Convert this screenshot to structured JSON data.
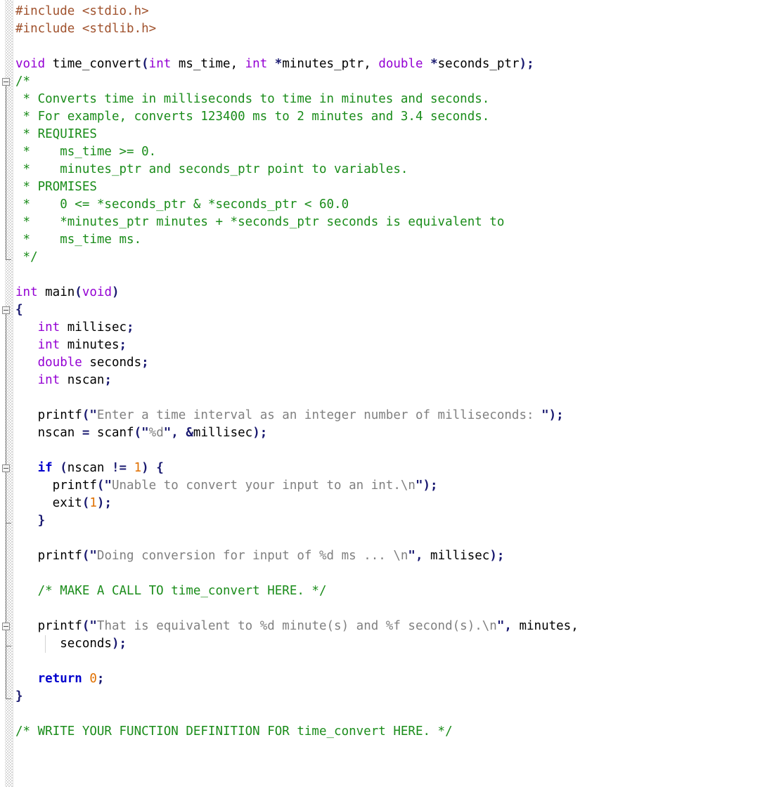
{
  "app": {
    "kind": "code-editor",
    "language": "C",
    "gutter_label": "code-folding-margin"
  },
  "theme": {
    "background": "#ffffff",
    "text": "#000000",
    "preprocessor": "#a0522d",
    "type_keyword": "#9400d3",
    "control_keyword": "#0000cd",
    "comment": "#1a8c1a",
    "string": "#808080",
    "punctuation": "#191970",
    "number": "#e07000",
    "gutter_line": "#767676",
    "gutter_box_border": "#8a8a8a"
  },
  "folding": {
    "markers": [
      {
        "name": "fold-marker-doc-comment",
        "state": "expanded",
        "glyph": "minus-box"
      },
      {
        "name": "fold-marker-main-body",
        "state": "expanded",
        "glyph": "minus-box"
      },
      {
        "name": "fold-marker-if-block",
        "state": "expanded",
        "glyph": "minus-box"
      },
      {
        "name": "fold-marker-printf-continuation",
        "state": "expanded",
        "glyph": "minus-box"
      }
    ]
  },
  "code": {
    "lines": [
      {
        "n": 1,
        "segs": [
          {
            "c": "t-pre",
            "t": "#include "
          },
          {
            "c": "t-hdr",
            "t": "<stdio.h>"
          }
        ]
      },
      {
        "n": 2,
        "segs": [
          {
            "c": "t-pre",
            "t": "#include "
          },
          {
            "c": "t-hdr",
            "t": "<stdlib.h>"
          }
        ]
      },
      {
        "n": 3,
        "segs": []
      },
      {
        "n": 4,
        "segs": [
          {
            "c": "t-kw",
            "t": "void"
          },
          {
            "c": "t-id",
            "t": " time_convert"
          },
          {
            "c": "t-punc",
            "t": "("
          },
          {
            "c": "t-kw",
            "t": "int"
          },
          {
            "c": "t-id",
            "t": " ms_time,"
          },
          {
            "c": "t-kw",
            "t": " int"
          },
          {
            "c": "t-punc",
            "t": " *"
          },
          {
            "c": "t-id",
            "t": "minutes_ptr,"
          },
          {
            "c": "t-kw",
            "t": " double"
          },
          {
            "c": "t-punc",
            "t": " *"
          },
          {
            "c": "t-id",
            "t": "seconds_ptr"
          },
          {
            "c": "t-punc",
            "t": ");"
          }
        ]
      },
      {
        "n": 5,
        "segs": [
          {
            "c": "t-cmt",
            "t": "/*"
          }
        ]
      },
      {
        "n": 6,
        "segs": [
          {
            "c": "t-cmt",
            "t": " * Converts time in milliseconds to time in minutes and seconds."
          }
        ]
      },
      {
        "n": 7,
        "segs": [
          {
            "c": "t-cmt",
            "t": " * For example, converts 123400 ms to 2 minutes and 3.4 seconds."
          }
        ]
      },
      {
        "n": 8,
        "segs": [
          {
            "c": "t-cmt",
            "t": " * REQUIRES"
          }
        ]
      },
      {
        "n": 9,
        "segs": [
          {
            "c": "t-cmt",
            "t": " *    ms_time >= 0."
          }
        ]
      },
      {
        "n": 10,
        "segs": [
          {
            "c": "t-cmt",
            "t": " *    minutes_ptr and seconds_ptr point to variables."
          }
        ]
      },
      {
        "n": 11,
        "segs": [
          {
            "c": "t-cmt",
            "t": " * PROMISES"
          }
        ]
      },
      {
        "n": 12,
        "segs": [
          {
            "c": "t-cmt",
            "t": " *    0 <= *seconds_ptr & *seconds_ptr < 60.0"
          }
        ]
      },
      {
        "n": 13,
        "segs": [
          {
            "c": "t-cmt",
            "t": " *    *minutes_ptr minutes + *seconds_ptr seconds is equivalent to"
          }
        ]
      },
      {
        "n": 14,
        "segs": [
          {
            "c": "t-cmt",
            "t": " *    ms_time ms."
          }
        ]
      },
      {
        "n": 15,
        "segs": [
          {
            "c": "t-cmt",
            "t": " */"
          }
        ]
      },
      {
        "n": 16,
        "segs": []
      },
      {
        "n": 17,
        "segs": [
          {
            "c": "t-kw",
            "t": "int"
          },
          {
            "c": "t-id",
            "t": " main"
          },
          {
            "c": "t-punc",
            "t": "("
          },
          {
            "c": "t-kw",
            "t": "void"
          },
          {
            "c": "t-punc",
            "t": ")"
          }
        ]
      },
      {
        "n": 18,
        "segs": [
          {
            "c": "t-punc",
            "t": "{"
          }
        ]
      },
      {
        "n": 19,
        "segs": [
          {
            "c": "t-kw",
            "t": "   int"
          },
          {
            "c": "t-id",
            "t": " millisec"
          },
          {
            "c": "t-punc",
            "t": ";"
          }
        ]
      },
      {
        "n": 20,
        "segs": [
          {
            "c": "t-kw",
            "t": "   int"
          },
          {
            "c": "t-id",
            "t": " minutes"
          },
          {
            "c": "t-punc",
            "t": ";"
          }
        ]
      },
      {
        "n": 21,
        "segs": [
          {
            "c": "t-kw",
            "t": "   double"
          },
          {
            "c": "t-id",
            "t": " seconds"
          },
          {
            "c": "t-punc",
            "t": ";"
          }
        ]
      },
      {
        "n": 22,
        "segs": [
          {
            "c": "t-kw",
            "t": "   int"
          },
          {
            "c": "t-id",
            "t": " nscan"
          },
          {
            "c": "t-punc",
            "t": ";"
          }
        ]
      },
      {
        "n": 23,
        "segs": []
      },
      {
        "n": 24,
        "segs": [
          {
            "c": "t-id",
            "t": "   printf"
          },
          {
            "c": "t-punc",
            "t": "(\""
          },
          {
            "c": "t-str",
            "t": "Enter a time interval as an integer number of milliseconds: "
          },
          {
            "c": "t-punc",
            "t": "\");"
          }
        ]
      },
      {
        "n": 25,
        "segs": [
          {
            "c": "t-id",
            "t": "   nscan "
          },
          {
            "c": "t-punc",
            "t": "="
          },
          {
            "c": "t-id",
            "t": " scanf"
          },
          {
            "c": "t-punc",
            "t": "(\""
          },
          {
            "c": "t-str",
            "t": "%d"
          },
          {
            "c": "t-punc",
            "t": "\", &"
          },
          {
            "c": "t-id",
            "t": "millisec"
          },
          {
            "c": "t-punc",
            "t": ");"
          }
        ]
      },
      {
        "n": 26,
        "segs": []
      },
      {
        "n": 27,
        "segs": [
          {
            "c": "t-kw2",
            "t": "   if"
          },
          {
            "c": "t-punc",
            "t": " ("
          },
          {
            "c": "t-id",
            "t": "nscan "
          },
          {
            "c": "t-punc",
            "t": "!="
          },
          {
            "c": "t-num",
            "t": " 1"
          },
          {
            "c": "t-punc",
            "t": ") {"
          }
        ]
      },
      {
        "n": 28,
        "segs": [
          {
            "c": "t-id",
            "t": "     printf"
          },
          {
            "c": "t-punc",
            "t": "(\""
          },
          {
            "c": "t-str",
            "t": "Unable to convert your input to an int.\\n"
          },
          {
            "c": "t-punc",
            "t": "\");"
          }
        ]
      },
      {
        "n": 29,
        "segs": [
          {
            "c": "t-id",
            "t": "     exit"
          },
          {
            "c": "t-punc",
            "t": "("
          },
          {
            "c": "t-num",
            "t": "1"
          },
          {
            "c": "t-punc",
            "t": ");"
          }
        ]
      },
      {
        "n": 30,
        "segs": [
          {
            "c": "t-punc",
            "t": "   }"
          }
        ]
      },
      {
        "n": 31,
        "segs": []
      },
      {
        "n": 32,
        "segs": [
          {
            "c": "t-id",
            "t": "   printf"
          },
          {
            "c": "t-punc",
            "t": "(\""
          },
          {
            "c": "t-str",
            "t": "Doing conversion for input of %d ms ... \\n"
          },
          {
            "c": "t-punc",
            "t": "\", "
          },
          {
            "c": "t-id",
            "t": "millisec"
          },
          {
            "c": "t-punc",
            "t": ");"
          }
        ]
      },
      {
        "n": 33,
        "segs": []
      },
      {
        "n": 34,
        "segs": [
          {
            "c": "t-cmt",
            "t": "   /* MAKE A CALL TO time_convert HERE. */"
          }
        ]
      },
      {
        "n": 35,
        "segs": []
      },
      {
        "n": 36,
        "segs": [
          {
            "c": "t-id",
            "t": "   printf"
          },
          {
            "c": "t-punc",
            "t": "(\""
          },
          {
            "c": "t-str",
            "t": "That is equivalent to %d minute(s) and %f second(s).\\n"
          },
          {
            "c": "t-punc",
            "t": "\", "
          },
          {
            "c": "t-id",
            "t": "minutes,"
          }
        ]
      },
      {
        "n": 37,
        "guide": true,
        "segs": [
          {
            "c": "t-id",
            "t": "      seconds"
          },
          {
            "c": "t-punc",
            "t": ");"
          }
        ]
      },
      {
        "n": 38,
        "segs": []
      },
      {
        "n": 39,
        "segs": [
          {
            "c": "t-kw2",
            "t": "   return"
          },
          {
            "c": "t-num",
            "t": " 0"
          },
          {
            "c": "t-punc",
            "t": ";"
          }
        ]
      },
      {
        "n": 40,
        "segs": [
          {
            "c": "t-punc",
            "t": "}"
          }
        ]
      },
      {
        "n": 41,
        "segs": []
      },
      {
        "n": 42,
        "segs": [
          {
            "c": "t-cmt",
            "t": "/* WRITE YOUR FUNCTION DEFINITION FOR time_convert HERE. */"
          }
        ]
      },
      {
        "n": 43,
        "segs": []
      },
      {
        "n": 44,
        "segs": []
      }
    ]
  }
}
